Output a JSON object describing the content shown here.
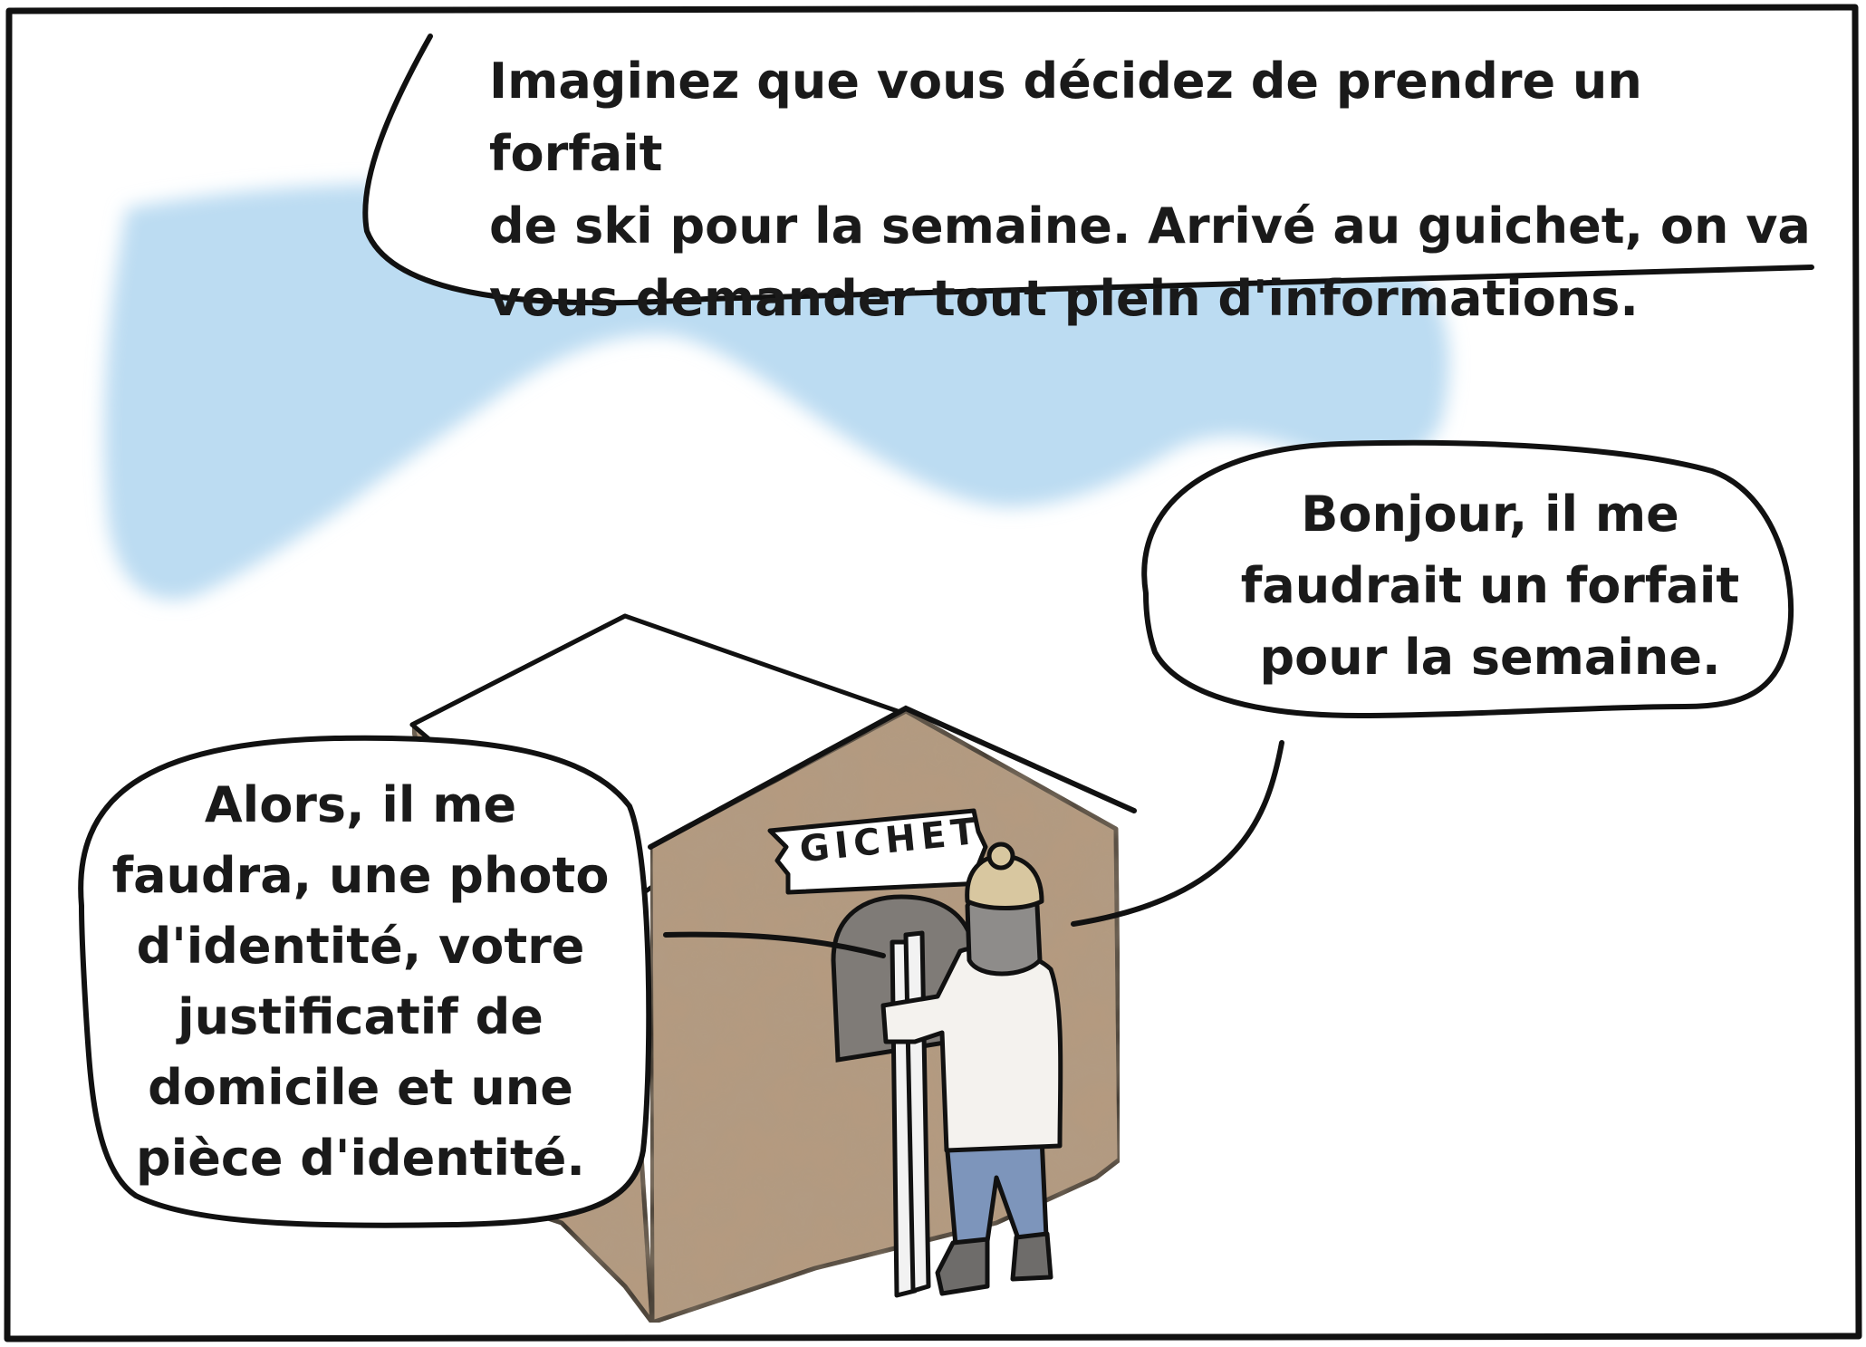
{
  "panel": {
    "narration": {
      "lines": [
        "Imaginez que vous décidez de prendre un forfait",
        "de ski pour la semaine. Arrivé au guichet, on va",
        "vous demander tout plein d'informations."
      ]
    },
    "customer_bubble": {
      "lines": [
        "Bonjour, il me",
        "faudrait un forfait",
        "pour la semaine."
      ]
    },
    "clerk_bubble": {
      "lines": [
        "Alors, il me",
        "faudra, une photo",
        "d'identité, votre",
        "justificatif de",
        "domicile et une",
        "pièce d'identité."
      ]
    },
    "booth_sign": "GICHET"
  },
  "colors": {
    "sky": "#bcdcf2",
    "booth": "#b59a7f",
    "outline": "#111111",
    "jacket": "#f4f2ee",
    "jeans": "#7d95bb",
    "hat": "#d8c7a0"
  },
  "icons": {
    "skier": "skier-figure",
    "booth": "ticket-booth",
    "skis": "skis"
  }
}
